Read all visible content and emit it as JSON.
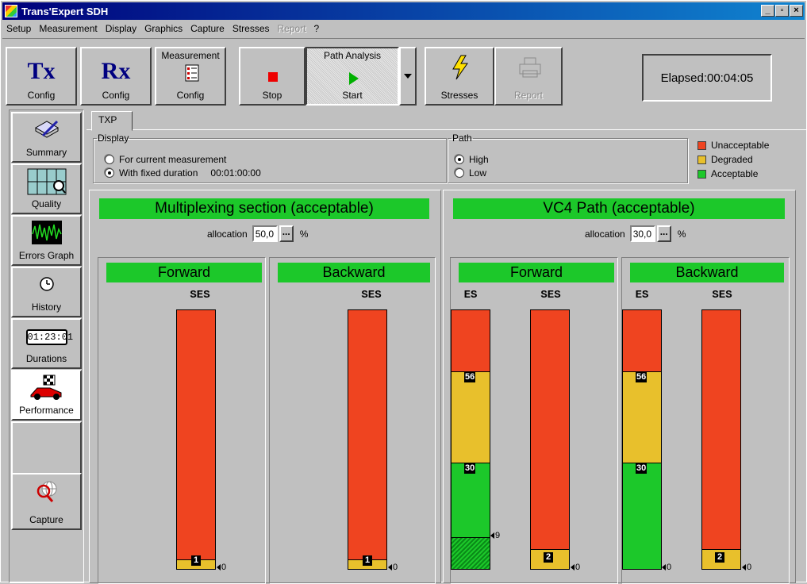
{
  "window": {
    "title": "Trans'Expert SDH",
    "min": "_",
    "max": "▫",
    "close": "×"
  },
  "menu": {
    "items": [
      "Setup",
      "Measurement",
      "Display",
      "Graphics",
      "Capture",
      "Stresses"
    ],
    "report": "Report",
    "help": "?"
  },
  "toolbar": {
    "tx": {
      "big": "Tx",
      "label": "Config"
    },
    "rx": {
      "big": "Rx",
      "label": "Config"
    },
    "meas": {
      "top": "Measurement",
      "label": "Config"
    },
    "stop": "Stop",
    "start": {
      "top": "Path Analysis",
      "label": "Start"
    },
    "stresses": "Stresses",
    "report": "Report",
    "elapsed": "Elapsed:00:04:05"
  },
  "sidebar": {
    "items": [
      "Summary",
      "Quality",
      "Errors Graph",
      "History",
      "Durations",
      "Performance",
      "Capture"
    ],
    "clock": "01:23:01"
  },
  "tab": "TXP",
  "display": {
    "legend": "Display",
    "opt1": "For current measurement",
    "opt2": "With fixed duration",
    "duration": "00:01:00:00"
  },
  "path": {
    "legend": "Path",
    "high": "High",
    "low": "Low"
  },
  "legend": {
    "items": [
      {
        "label": "Unacceptable",
        "color": "#ef4420"
      },
      {
        "label": "Degraded",
        "color": "#e8c02c"
      },
      {
        "label": "Acceptable",
        "color": "#1cc82a"
      }
    ]
  },
  "ms": {
    "title": "Multiplexing section (acceptable)",
    "alloc_label": "allocation",
    "alloc": "50,0",
    "dots": "...",
    "pct": "%",
    "fwd": {
      "title": "Forward",
      "col": "SES",
      "mark": "1",
      "zero": "0"
    },
    "bwd": {
      "title": "Backward",
      "col": "SES",
      "mark": "1",
      "zero": "0"
    }
  },
  "vc4": {
    "title": "VC4 Path (acceptable)",
    "alloc_label": "allocation",
    "alloc": "30,0",
    "dots": "...",
    "pct": "%",
    "fwd": {
      "title": "Forward",
      "es": "ES",
      "ses": "SES",
      "es_m1": "56",
      "es_m2": "30",
      "es_val": "9",
      "ses_mark": "2",
      "zero": "0"
    },
    "bwd": {
      "title": "Backward",
      "es": "ES",
      "ses": "SES",
      "es_m1": "56",
      "es_m2": "30",
      "ses_mark": "2",
      "zero1": "0",
      "zero2": "0"
    }
  }
}
